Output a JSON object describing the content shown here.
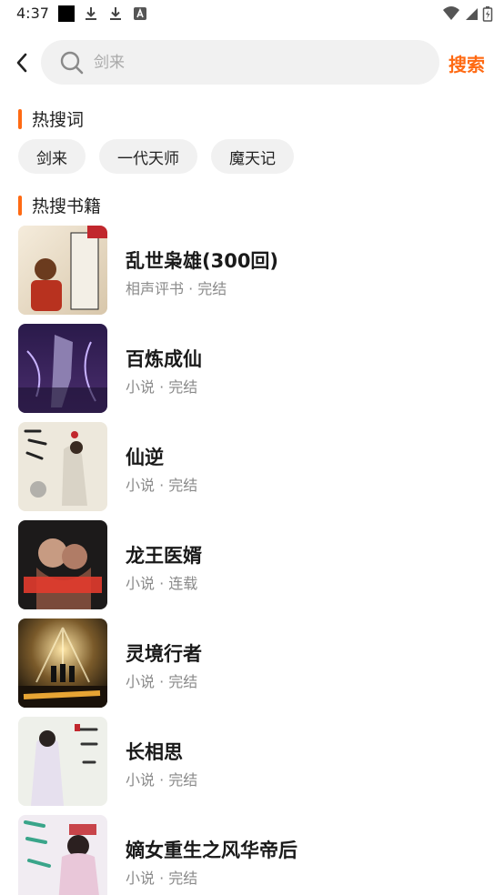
{
  "status_bar": {
    "time": "4:37",
    "left_icons": [
      "black-square-icon",
      "download-icon",
      "download-icon",
      "font-icon"
    ],
    "right_icons": [
      "wifi-icon",
      "cell-signal-icon",
      "battery-icon"
    ]
  },
  "search": {
    "placeholder": "剑来",
    "button_label": "搜索"
  },
  "hot_words": {
    "title": "热搜词",
    "items": [
      "剑来",
      "一代天师",
      "魔天记"
    ]
  },
  "hot_books": {
    "title": "热搜书籍",
    "items": [
      {
        "title": "乱世枭雄(300回)",
        "category": "相声评书",
        "status": "完结"
      },
      {
        "title": "百炼成仙",
        "category": "小说",
        "status": "完结"
      },
      {
        "title": "仙逆",
        "category": "小说",
        "status": "完结"
      },
      {
        "title": "龙王医婿",
        "category": "小说",
        "status": "连载"
      },
      {
        "title": "灵境行者",
        "category": "小说",
        "status": "完结"
      },
      {
        "title": "长相思",
        "category": "小说",
        "status": "完结"
      },
      {
        "title": "嫡女重生之风华帝后",
        "category": "小说",
        "status": "完结"
      }
    ],
    "meta_separator": " · "
  },
  "colors": {
    "accent": "#ff6a13",
    "chip_bg": "#f1f1f1",
    "meta_text": "#8a8a8a"
  }
}
